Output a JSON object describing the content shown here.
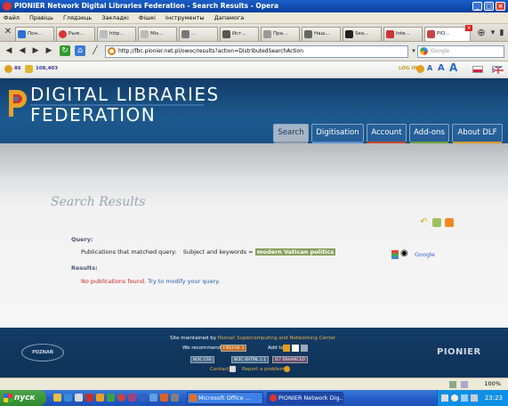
{
  "window": {
    "title": "PIONIER Network Digital Libraries Federation - Search Results - Opera",
    "controls": [
      "_",
      "□",
      "×"
    ]
  },
  "menu": [
    "Файл",
    "Правіць",
    "Глядзець",
    "Закладкі",
    "Фішкі",
    "Інструменты",
    "Дапамога"
  ],
  "tabs": [
    {
      "label": "Пон...",
      "color": "#2a6fd6"
    },
    {
      "label": "Рыж...",
      "color": "#d33"
    },
    {
      "label": "http...",
      "color": "#888"
    },
    {
      "label": "Mis...",
      "color": "#888"
    },
    {
      "label": "...",
      "color": "#666"
    },
    {
      "label": "Ист...",
      "color": "#555"
    },
    {
      "label": "Пра...",
      "color": "#888"
    },
    {
      "label": "Наш...",
      "color": "#666"
    },
    {
      "label": "Sea...",
      "color": "#222"
    },
    {
      "label": "Inte...",
      "color": "#c33"
    },
    {
      "label": "PIO...",
      "color": "#c44"
    }
  ],
  "address": {
    "url": "http://fbc.pionier.net.pl/owoc/results?action=DistributedSearchAction",
    "search_placeholder": "Google"
  },
  "site": {
    "stats": {
      "first": "86",
      "second": "108,403"
    },
    "login_label": "LOG IN",
    "font_sizes": [
      "A",
      "A",
      "A"
    ],
    "logo_line1": "DIGITAL LIBRARIES",
    "logo_line2": "FEDERATION",
    "nav": [
      {
        "label": "Search",
        "bar": "#8b96a6"
      },
      {
        "label": "Digitisation",
        "bar": "#5a8fd0"
      },
      {
        "label": "Account",
        "bar": "#c8452c"
      },
      {
        "label": "Add-ons",
        "bar": "#6aa23a"
      },
      {
        "label": "About DLF",
        "bar": "#d89a2a"
      }
    ]
  },
  "results": {
    "page_title": "Search Results",
    "query_label": "Query:",
    "matched_prefix": "Publications that matched query:",
    "matched_field": "Subject and keywords =",
    "query_value": "modern Vatican politics",
    "results_label": "Results:",
    "no_results": "No publications found.",
    "modify_link": "Try to modify your query.",
    "google_label": "Google"
  },
  "footer": {
    "maintained_prefix": "Site maintained by",
    "maintained_org": "Poznań Supercomputing and Networking Center",
    "recommend": "We recommend",
    "add_to": "Add to",
    "badges": [
      "FIREFOX 3",
      "W3C CSS",
      "W3C XHTML 1.1",
      "IE7 ENHANCED"
    ],
    "contact": "Contact",
    "report": "Report a problem",
    "left_logo": "POZNAŃ",
    "right_logo": "PIONIER"
  },
  "statusbar": {
    "zoom": "100%"
  },
  "taskbar": {
    "start": "пуск",
    "buttons": [
      "Microsoft Office ...",
      "PIONIER Network Dig..."
    ],
    "clock": "23:23"
  }
}
